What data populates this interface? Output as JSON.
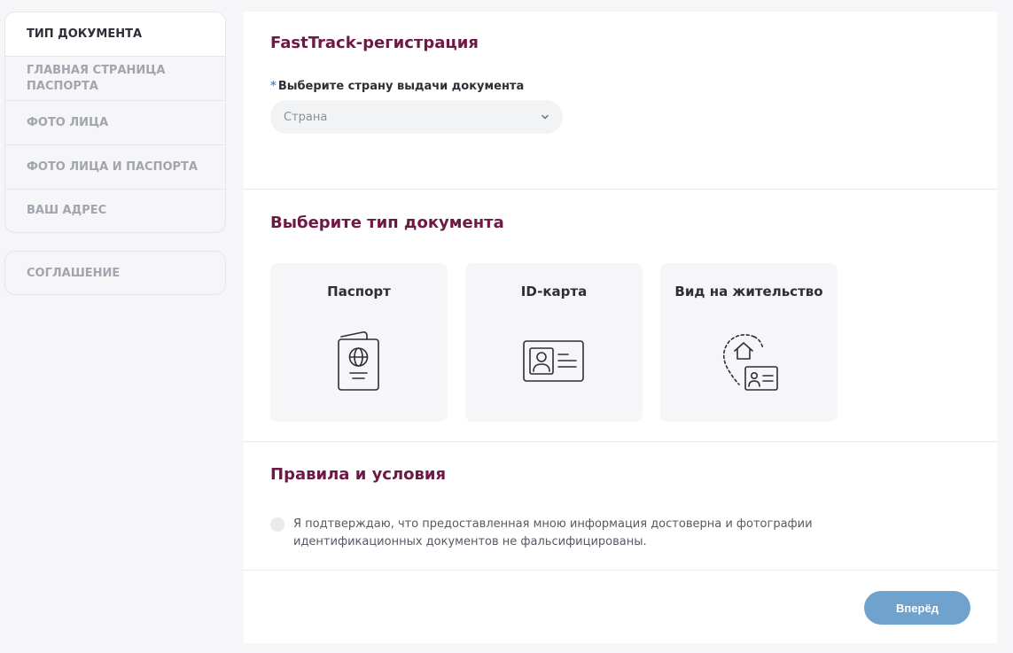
{
  "sidebar": {
    "steps": [
      {
        "label": "Тип документа"
      },
      {
        "label": "Главная страница паспорта"
      },
      {
        "label": "Фото лица"
      },
      {
        "label": "Фото лица и паспорта"
      },
      {
        "label": "Ваш адрес"
      }
    ],
    "agreement": "Соглашение"
  },
  "registration": {
    "title": "FastTrack-регистрация",
    "required_mark": "*",
    "country_label": "Выберите страну выдачи документа",
    "country_placeholder": "Страна"
  },
  "doc_type": {
    "title": "Выберите тип документа",
    "cards": [
      {
        "label": "Паспорт",
        "icon": "passport-icon"
      },
      {
        "label": "ID-карта",
        "icon": "id-card-icon"
      },
      {
        "label": "Вид на жительство",
        "icon": "residence-permit-icon"
      }
    ]
  },
  "terms": {
    "title": "Правила и условия",
    "consent": "Я подтверждаю, что предоставленная мною информация достоверна и фотографии идентификационных документов не фальсифицированы."
  },
  "footer": {
    "next_label": "Вперёд"
  },
  "colors": {
    "title": "#6e1845",
    "accent": "#6fa2cc",
    "required": "#4f8ec5"
  }
}
